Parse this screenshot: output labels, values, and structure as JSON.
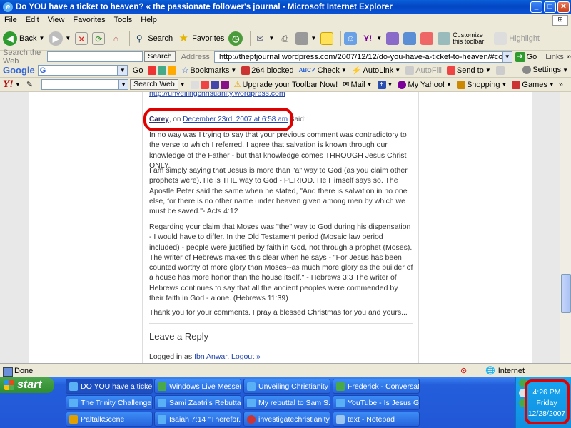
{
  "window": {
    "title": "Do YOU have a ticket to heaven? « the passionate follower's journal - Microsoft Internet Explorer"
  },
  "menu": [
    "File",
    "Edit",
    "View",
    "Favorites",
    "Tools",
    "Help"
  ],
  "std_toolbar": {
    "back": "Back",
    "search": "Search",
    "favorites": "Favorites",
    "customize": "Customize this toolbar",
    "highlight": "Highlight"
  },
  "address_row": {
    "search_label": "Search the Web",
    "search_button": "Search",
    "address_label": "Address",
    "url": "http://thepfjournal.wordpress.com/2007/12/12/do-you-have-a-ticket-to-heaven/#comment-301",
    "go": "Go",
    "links": "Links"
  },
  "google_bar": {
    "logo": "Google",
    "go": "Go",
    "bookmarks": "Bookmarks",
    "blocked": "264 blocked",
    "check": "Check",
    "autolink": "AutoLink",
    "autofill": "AutoFill",
    "sendto": "Send to",
    "settings": "Settings"
  },
  "yahoo_bar": {
    "logo": "Y!",
    "search_web": "Search Web",
    "upgrade": "Upgrade your Toolbar Now!",
    "mail": "Mail",
    "myyahoo": "My Yahoo!",
    "shopping": "Shopping",
    "games": "Games"
  },
  "page": {
    "prev_link": "http://unveilingchristianity.wordpress.com",
    "comment": {
      "author": "Carey",
      "on": ", on ",
      "date": "December 23rd, 2007 at 6:58 am",
      "said": " Said:",
      "paragraphs": [
        "In no way was I trying to say that your previous comment was contradictory to the verse to which I referred. I agree that salvation is known through our knowledge of the Father - but that knowledge comes THROUGH Jesus Christ ONLY.",
        "I am simply saying that Jesus is more than \"a\" way to God (as you claim other prophets were). He is THE way to God - PERIOD. He Himself says so. The Apostle Peter said the same when he stated, \"And there is salvation in no one else, for there is no other name under heaven given among men by which we must be saved.\"- Acts 4:12",
        "Regarding your claim that Moses was \"the\" way to God during his dispensation - I would have to differ. In the Old Testament period (Mosaic law period included) - people were justified by faith in God, not through a prophet (Moses). The writer of Hebrews makes this clear when he says - \"For Jesus has been counted worthy of more glory than Moses--as much more glory as the builder of a house has more honor than the house itself.\" - Hebrews 3:3 The writer of Hebrews continues to say that all the ancient peoples were commended by their faith in God - alone. (Hebrews 11:39)",
        "Thank you for your comments. I pray a blessed Christmas for you and yours..."
      ]
    },
    "leave_reply": "Leave a Reply",
    "logged_in_as": "Logged in as ",
    "user": "Ibn Anwar",
    "logout": "Logout »"
  },
  "status": {
    "text": "Done",
    "zone": "Internet"
  },
  "taskbar": {
    "start": "start",
    "tasks": [
      "DO YOU have a ticket...",
      "Windows Live Messen...",
      "Unveiling Christianity ...",
      "Frederick - Conversat...",
      "The Trinity Challenge...",
      "Sami Zaatri's Rebuttal...",
      "My rebuttal to Sam S...",
      "YouTube - Is Jesus G...",
      "PaltalkScene",
      "Isaiah 7:14 \"Therefor...",
      "investigatechristianity",
      "text - Notepad"
    ],
    "clock": {
      "time": "4:26 PM",
      "day": "Friday",
      "date": "12/28/2007"
    }
  }
}
